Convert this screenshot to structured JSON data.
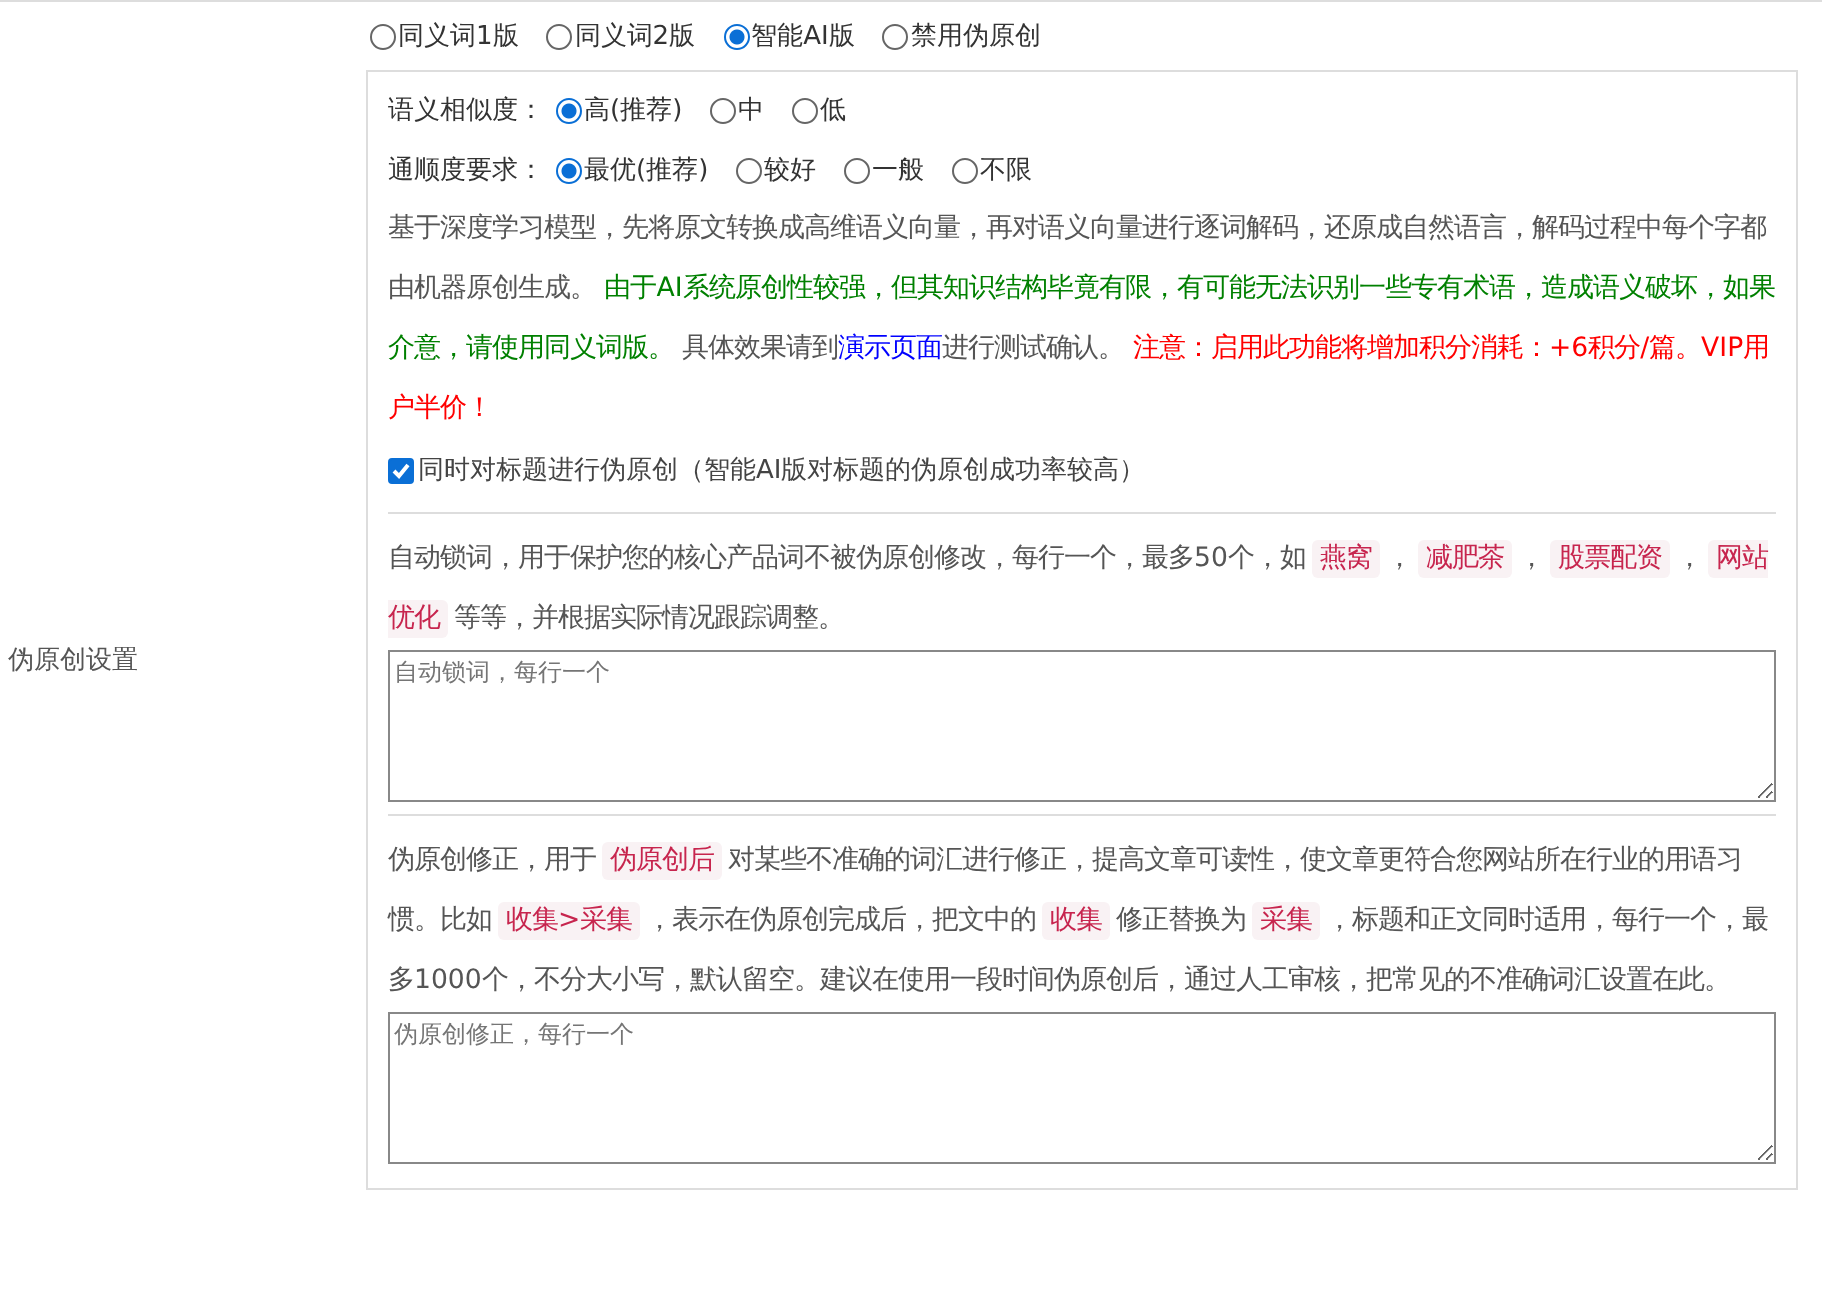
{
  "side_label": "伪原创设置",
  "modes": [
    {
      "label": "同义词1版",
      "selected": false
    },
    {
      "label": "同义词2版",
      "selected": false
    },
    {
      "label": "智能AI版",
      "selected": true
    },
    {
      "label": "禁用伪原创",
      "selected": false
    }
  ],
  "option_groups": [
    {
      "label": "语义相似度：",
      "options": [
        {
          "label": "高(推荐)",
          "selected": true
        },
        {
          "label": "中",
          "selected": false
        },
        {
          "label": "低",
          "selected": false
        }
      ]
    },
    {
      "label": "通顺度要求：",
      "options": [
        {
          "label": "最优(推荐)",
          "selected": true
        },
        {
          "label": "较好",
          "selected": false
        },
        {
          "label": "一般",
          "selected": false
        },
        {
          "label": "不限",
          "selected": false
        }
      ]
    }
  ],
  "description": [
    {
      "kind": "plain",
      "text": "基于深度学习模型，先将原文转换成高维语义向量，再对语义向量进行逐词解码，还原成自然语言，解码过程中每个字都由机器原创生成。 "
    },
    {
      "kind": "green",
      "text": "由于AI系统原创性较强，但其知识结构毕竟有限，有可能无法识别一些专有术语，造成语义破坏，如果介意，请使用同义词版。"
    },
    {
      "kind": "plain",
      "text": " 具体效果请到"
    },
    {
      "kind": "link",
      "text": "演示页面"
    },
    {
      "kind": "plain",
      "text": "进行测试确认。 "
    },
    {
      "kind": "red",
      "text": "注意：启用此功能将增加积分消耗：+6积分/篇。VIP用户半价！"
    }
  ],
  "title_option": {
    "label": "同时对标题进行伪原创（智能AI版对标题的伪原创成功率较高）",
    "checked": true
  },
  "lock_words": {
    "description": [
      {
        "kind": "plain",
        "text": "自动锁词，用于保护您的核心产品词不被伪原创修改，每行一个，最多50个，如"
      },
      {
        "kind": "code",
        "text": "燕窝"
      },
      {
        "kind": "plain",
        "text": "，"
      },
      {
        "kind": "code",
        "text": "减肥茶"
      },
      {
        "kind": "plain",
        "text": "，"
      },
      {
        "kind": "code",
        "text": "股票配资"
      },
      {
        "kind": "plain",
        "text": "，"
      },
      {
        "kind": "code",
        "text": "网站优化"
      },
      {
        "kind": "plain",
        "text": "等等，并根据实际情况跟踪调整。"
      }
    ],
    "placeholder": "自动锁词，每行一个"
  },
  "corrections": {
    "description": [
      {
        "kind": "plain",
        "text": "伪原创修正，用于"
      },
      {
        "kind": "code",
        "text": "伪原创后"
      },
      {
        "kind": "plain",
        "text": "对某些不准确的词汇进行修正，提高文章可读性，使文章更符合您网站所在行业的用语习惯。比如"
      },
      {
        "kind": "code",
        "text": "收集>采集"
      },
      {
        "kind": "plain",
        "text": "，表示在伪原创完成后，把文中的"
      },
      {
        "kind": "code",
        "text": "收集"
      },
      {
        "kind": "plain",
        "text": "修正替换为"
      },
      {
        "kind": "code",
        "text": "采集"
      },
      {
        "kind": "plain",
        "text": "，标题和正文同时适用，每行一个，最多1000个，不分大小写，默认留空。建议在使用一段时间伪原创后，通过人工审核，把常见的不准确词汇设置在此。"
      }
    ],
    "placeholder": "伪原创修正，每行一个"
  }
}
